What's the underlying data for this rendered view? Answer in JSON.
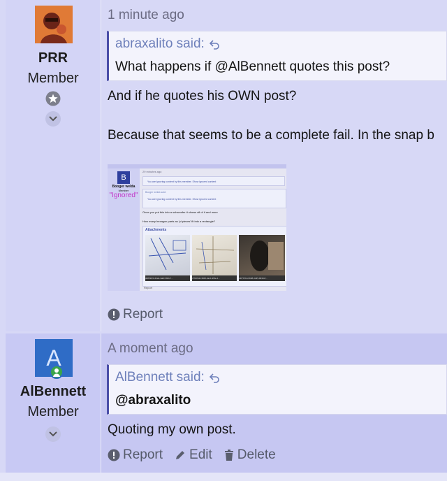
{
  "posts": [
    {
      "author": "PRR",
      "role": "Member",
      "time": "1 minute ago",
      "quote": {
        "header": "abraxalito said:",
        "body": "What happens if @AlBennett quotes this post?"
      },
      "lines": [
        "And if he quotes his OWN post?",
        "Because that seems to be a complete fail. In the snap b"
      ],
      "attachment": {
        "time": "29 minutes ago",
        "user": "Booger welda",
        "role": "Member",
        "ignored": "\"Ignored\"",
        "ignored_notice": "You are ignoring content by this member. Show ignored content",
        "quote_header": "Booger welda said:",
        "line1": "Once you put this into a subwoofer it shows all of it and more",
        "line2": "How many hexagon parts as 'pi pieces' fit into a rectangle?",
        "attachments_title": "Attachments",
        "captions": [
          "d8839f23-4ba4-4a8c-89f4-7...",
          "c7f1b5d4-3846-4ac1-9f8e-4...",
          "23f7b7b4-9608-4d35-9930-8..."
        ],
        "report": "Report"
      },
      "actions": [
        "Report"
      ]
    },
    {
      "author": "AlBennett",
      "avatar_letter": "A",
      "role": "Member",
      "time": "A moment ago",
      "quote": {
        "header": "AlBennett said:",
        "body": "@abraxalito"
      },
      "lines": [
        "Quoting my own post."
      ],
      "actions": [
        "Report",
        "Edit",
        "Delete"
      ]
    }
  ],
  "colors": {
    "accent": "#4b4fa8",
    "post_bg": "#d7d8f6",
    "post_bg_alt": "#c6c7f2",
    "online": "#3aa54a",
    "avatar_blue": "#2f6cc6"
  }
}
